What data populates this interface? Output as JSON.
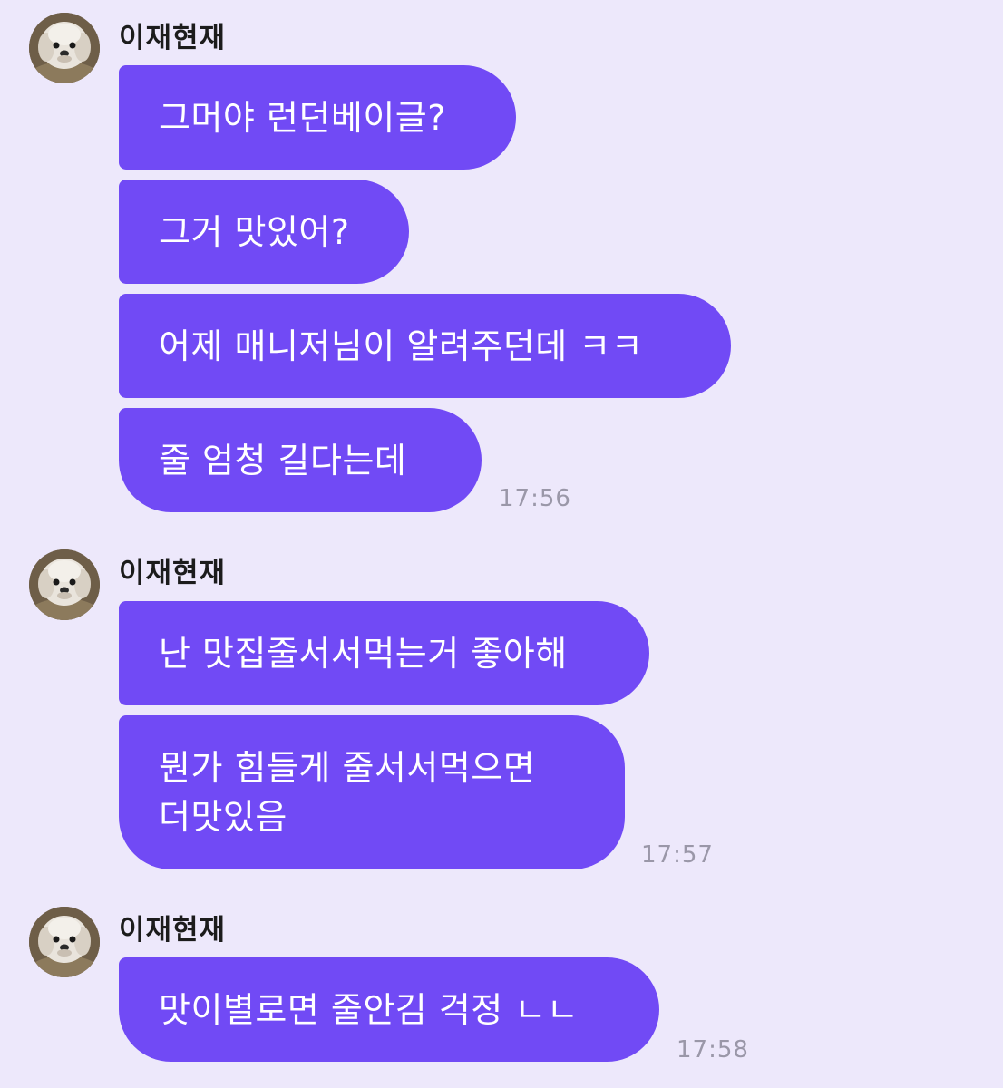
{
  "colors": {
    "background": "#EDE8FB",
    "bubble": "#714AF5",
    "bubble_text": "#FFFFFF",
    "sender_text": "#1C1C1C",
    "time_text": "#9A97A8"
  },
  "groups": [
    {
      "sender": "이재현재",
      "avatar_icon": "dog-avatar-icon",
      "messages": [
        "그머야 런던베이글?",
        "그거 맛있어?",
        "어제 매니저님이 알려주던데 ㅋㅋ",
        "줄 엄청 길다는데"
      ],
      "time": "17:56"
    },
    {
      "sender": "이재현재",
      "avatar_icon": "dog-avatar-icon",
      "messages": [
        "난 맛집줄서서먹는거 좋아해",
        "뭔가 힘들게 줄서서먹으면\n더맛있음"
      ],
      "time": "17:57"
    },
    {
      "sender": "이재현재",
      "avatar_icon": "dog-avatar-icon",
      "messages": [
        "맛이별로면 줄안김 걱정 ㄴㄴ"
      ],
      "time": "17:58"
    }
  ]
}
